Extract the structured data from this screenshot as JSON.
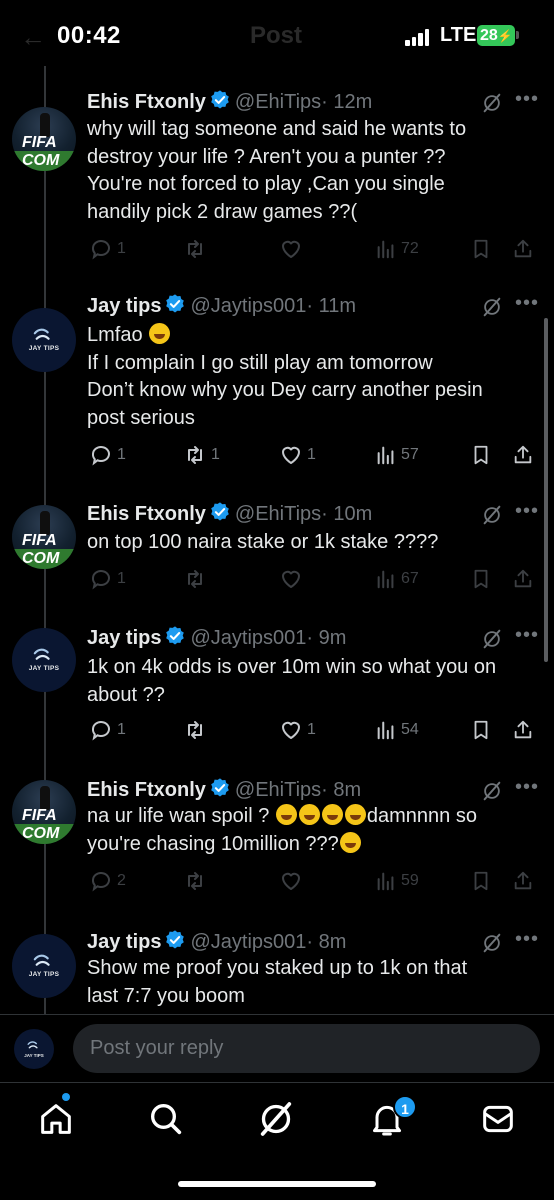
{
  "status_bar": {
    "time": "00:42",
    "network": "LTE",
    "battery": "28",
    "ghost_title": "Post"
  },
  "tweets": [
    {
      "name": "Ehis Ftxonly",
      "handle": "@EhiTips",
      "time": "· 12m",
      "lines": [
        "why will tag someone and  said he wants to",
        "destroy your life ? Aren't you a punter ??",
        "You're not forced to play ,Can you single",
        "handily pick 2 draw games ??("
      ],
      "replies": "1",
      "reposts": "",
      "likes": "",
      "views": "72",
      "dim": true
    },
    {
      "name": "Jay tips",
      "handle": "@Jaytips001",
      "time": "· 11m",
      "lines": [
        "Lmfao ",
        "If I complain I go still play am tomorrow",
        "Don’t know why you Dey carry another pesin",
        "post serious"
      ],
      "replies": "1",
      "reposts": "1",
      "likes": "1",
      "views": "57",
      "dim": false
    },
    {
      "name": "Ehis Ftxonly",
      "handle": "@EhiTips",
      "time": "· 10m",
      "lines": [
        "on top 100 naira  stake or 1k stake ????"
      ],
      "replies": "1",
      "reposts": "",
      "likes": "",
      "views": "67",
      "dim": true
    },
    {
      "name": "Jay tips",
      "handle": "@Jaytips001",
      "time": "· 9m",
      "lines": [
        "1k on 4k odds is over 10m win so what you on",
        "about ??"
      ],
      "replies": "1",
      "reposts": "",
      "likes": "1",
      "views": "54",
      "dim": false
    },
    {
      "name": "Ehis Ftxonly",
      "handle": "@EhiTips",
      "time": "· 8m",
      "lines": [
        "na ur life wan spoil ? ",
        "damnnnn so",
        "you're chasing 10million ???"
      ],
      "replies": "2",
      "reposts": "",
      "likes": "",
      "views": "59",
      "dim": true
    },
    {
      "name": "Jay tips",
      "handle": "@Jaytips001",
      "time": "· 8m",
      "lines": [
        "Show me proof you staked up to 1k on that",
        "last 7:7 you boom"
      ]
    }
  ],
  "avatar_text": "JAY TIPS",
  "avatar_ehis_text": "FIFA COM",
  "reply": {
    "placeholder": "Post your reply"
  },
  "tab_bar": {
    "notifications_badge": "1"
  },
  "colors": {
    "accent": "#1d9bf0",
    "battery": "#34c759"
  }
}
